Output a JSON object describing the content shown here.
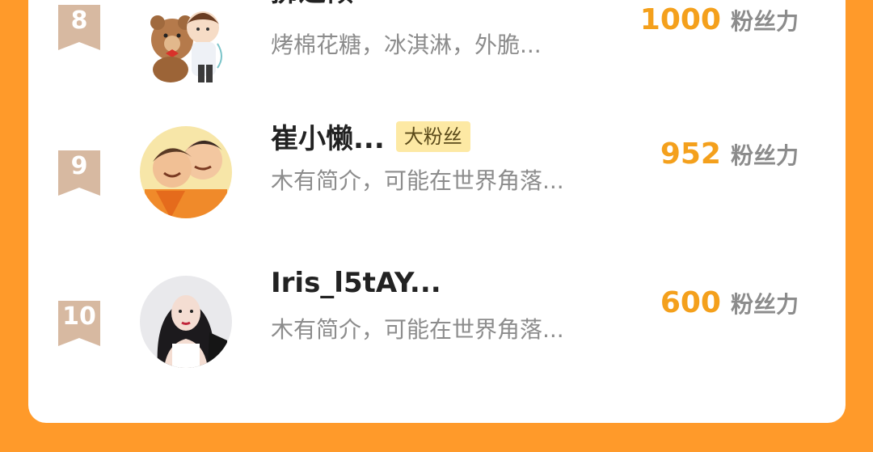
{
  "rows": [
    {
      "rank": "8",
      "name": "拂之倾",
      "description": "烤棉花糖，冰淇淋，外脆...",
      "fans_value": "1000",
      "fans_label": "粉丝力",
      "avatar": "anime-couple-with-teddy-bear-avatar"
    },
    {
      "rank": "9",
      "name": "崔小懒...",
      "badge": "大粉丝",
      "description": "木有简介，可能在世界角落...",
      "fans_value": "952",
      "fans_label": "粉丝力",
      "avatar": "anime-characters-avatar"
    },
    {
      "rank": "10",
      "name": "Iris_l5tAY...",
      "description": "木有简介，可能在世界角落...",
      "fans_value": "600",
      "fans_label": "粉丝力",
      "avatar": "portrait-photo-avatar"
    }
  ],
  "colors": {
    "background": "#ff9a2a",
    "card": "#ffffff",
    "rank_badge": "#d7b9a1",
    "fans_value": "#f4a01c",
    "badge_bg": "#fde9a4",
    "description": "#8c8c8c",
    "name": "#222222"
  }
}
